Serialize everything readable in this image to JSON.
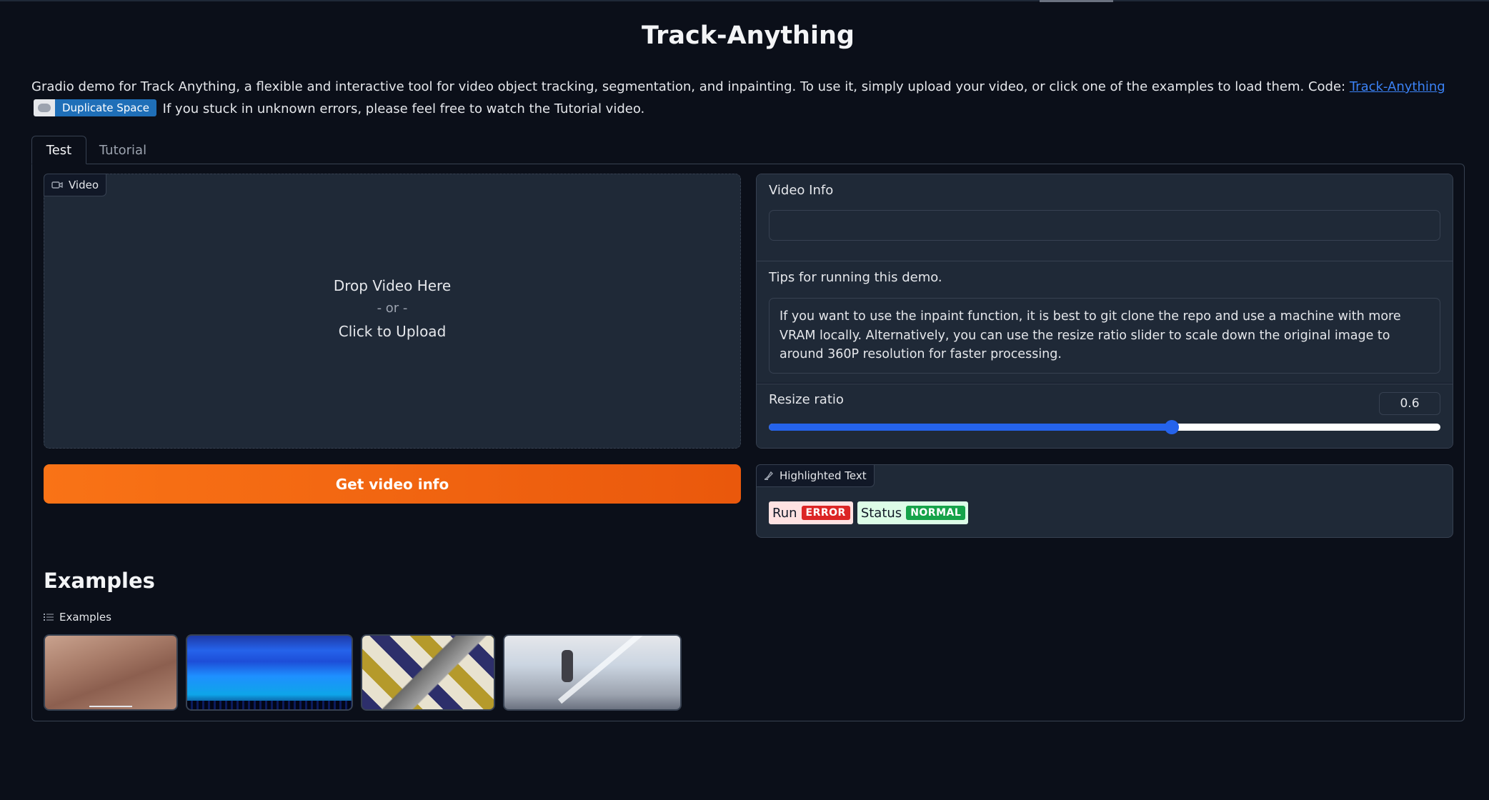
{
  "app": {
    "title": "Track-Anything",
    "description": {
      "prefix": "Gradio demo for Track Anything, a flexible and interactive tool for video object tracking, segmentation, and inpainting. To use it, simply upload your video, or click one of the examples to load them. Code: ",
      "link_text": "Track-Anything",
      "badge_label": "Duplicate Space",
      "suffix": " If you stuck in unknown errors, please feel free to watch the Tutorial video."
    }
  },
  "tabs": [
    {
      "label": "Test",
      "active": true
    },
    {
      "label": "Tutorial",
      "active": false
    }
  ],
  "video_input": {
    "label": "Video",
    "icon": "video-icon",
    "drop_text": "Drop Video Here",
    "or_text": "- or -",
    "upload_text": "Click to Upload"
  },
  "get_info_button": {
    "label": "Get video info",
    "color": "#f97316"
  },
  "video_info": {
    "label": "Video Info",
    "value": ""
  },
  "tips": {
    "label": "Tips for running this demo.",
    "text": "If you want to use the inpaint function, it is best to git clone the repo and use a machine with more VRAM locally. Alternatively, you can use the resize ratio slider to scale down the original image to around 360P resolution for faster processing."
  },
  "resize_ratio": {
    "label": "Resize ratio",
    "value": "0.6",
    "fraction": 0.6
  },
  "highlighted_text": {
    "label": "Highlighted Text",
    "icon": "highlight-icon",
    "tokens": [
      {
        "text": "Run",
        "tag": "ERROR",
        "tag_color": "#dc2626",
        "bg_color": "#fee2e2"
      },
      {
        "text": "Status",
        "tag": "NORMAL",
        "tag_color": "#16a34a",
        "bg_color": "#dcfce7"
      }
    ]
  },
  "examples": {
    "heading": "Examples",
    "label": "Examples",
    "icon": "list-icon",
    "count": 4
  }
}
